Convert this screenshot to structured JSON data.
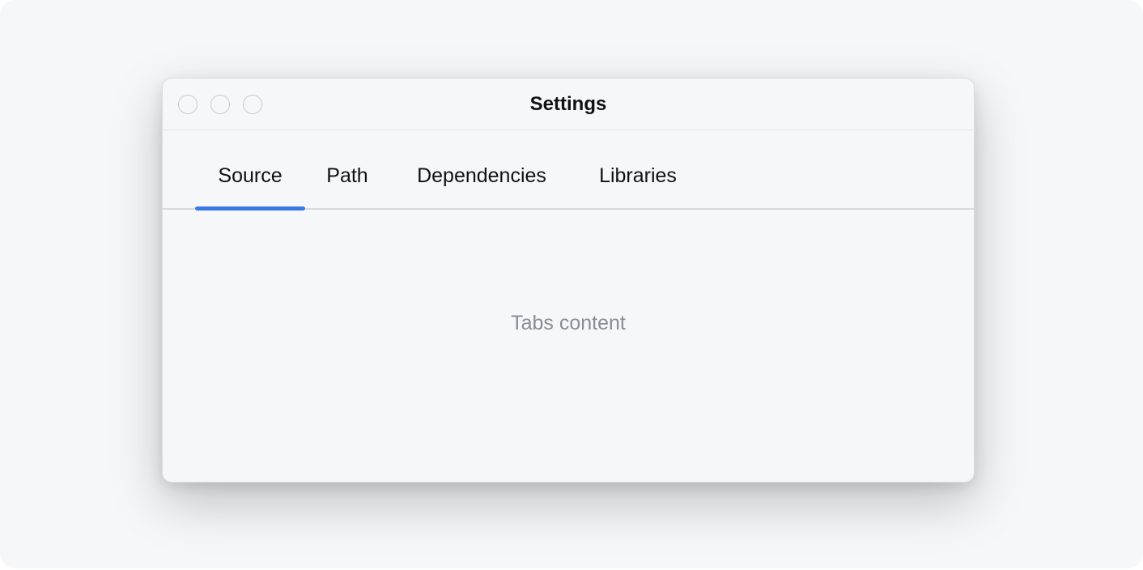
{
  "window": {
    "title": "Settings",
    "controls": [
      "close",
      "minimize",
      "maximize"
    ]
  },
  "tabs": [
    {
      "label": "Source",
      "selected": true
    },
    {
      "label": "Path",
      "selected": false
    },
    {
      "label": "Dependencies",
      "selected": false
    },
    {
      "label": "Libraries",
      "selected": false
    }
  ],
  "content": {
    "text": "Tabs content"
  },
  "colors": {
    "accent": "#3b78e7",
    "background": "#f6f7f9",
    "text": "#111111",
    "muted_text": "#8a8c94"
  }
}
